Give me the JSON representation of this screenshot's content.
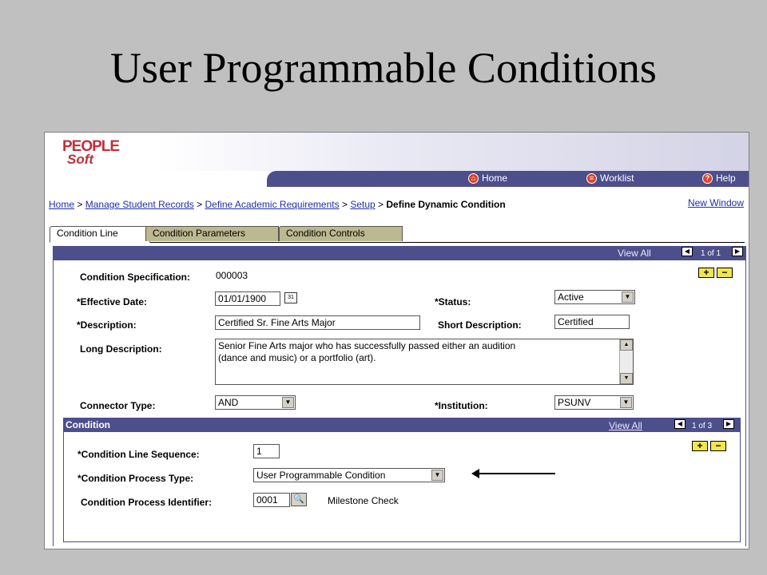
{
  "slide_title": "User Programmable Conditions",
  "logo": {
    "line1": "PEOPLE",
    "line2": "Soft"
  },
  "nav": {
    "home": "Home",
    "worklist": "Worklist",
    "help": "Help"
  },
  "breadcrumb": {
    "items": [
      "Home",
      "Manage Student Records",
      "Define Academic Requirements",
      "Setup"
    ],
    "sep": ">",
    "current": "Define Dynamic Condition"
  },
  "new_window": "New Window",
  "tabs": [
    "Condition Line",
    "Condition Parameters",
    "Condition Controls"
  ],
  "main_bar": {
    "view_all": "View All",
    "pager": "1 of 1"
  },
  "form": {
    "condition_spec_label": "Condition Specification:",
    "condition_spec_value": "000003",
    "eff_date_label": "*Effective Date:",
    "eff_date_value": "01/01/1900",
    "status_label": "*Status:",
    "status_value": "Active",
    "desc_label": "*Description:",
    "desc_value": "Certified Sr. Fine Arts Major",
    "short_desc_label": "Short Description:",
    "short_desc_value": "Certified",
    "long_desc_label": "Long Description:",
    "long_desc_line1": "Senior Fine Arts major who has successfully passed either an audition",
    "long_desc_line2": "(dance and music) or a portfolio (art).",
    "connector_label": "Connector Type:",
    "connector_value": "AND",
    "institution_label": "*Institution:",
    "institution_value": "PSUNV"
  },
  "condition": {
    "title": "Condition",
    "view_all": "View All",
    "pager": "1 of 3",
    "seq_label": "*Condition Line Sequence:",
    "seq_value": "1",
    "process_type_label": "*Condition Process Type:",
    "process_type_value": "User Programmable Condition",
    "process_id_label": "Condition Process Identifier:",
    "process_id_value": "0001",
    "process_id_desc": "Milestone Check"
  },
  "buttons": {
    "plus": "+",
    "minus": "−"
  }
}
